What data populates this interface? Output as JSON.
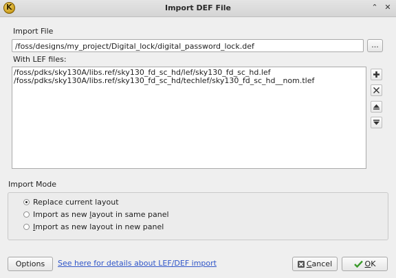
{
  "window": {
    "title": "Import DEF File",
    "app_icon_letter": "K"
  },
  "import_file": {
    "label": "Import File",
    "value": "/foss/designs/my_project/Digital_lock/digital_password_lock.def",
    "browse_label": "..."
  },
  "lef": {
    "label": "With LEF files:",
    "files": [
      "/foss/pdks/sky130A/libs.ref/sky130_fd_sc_hd/lef/sky130_fd_sc_hd.lef",
      "/foss/pdks/sky130A/libs.ref/sky130_fd_sc_hd/techlef/sky130_fd_sc_hd__nom.tlef"
    ],
    "buttons": [
      "add-icon",
      "remove-icon",
      "move-up-icon",
      "move-down-icon"
    ]
  },
  "import_mode": {
    "label": "Import Mode",
    "selected": 0,
    "options": [
      {
        "label": "Replace current layout",
        "mnemonic_prefix": "Replace current layout",
        "mnemonic": "",
        "rest": ""
      },
      {
        "label": "Import as new layout in same panel",
        "mnemonic_prefix": "Import as new ",
        "mnemonic": "l",
        "rest": "ayout in same panel"
      },
      {
        "label": "Import as new layout in new panel",
        "mnemonic_prefix": "",
        "mnemonic": "I",
        "rest": "mport as new layout in new panel"
      }
    ]
  },
  "footer": {
    "options_label": "Options",
    "help_link": "See here for details about LEF/DEF import",
    "cancel_label": "Cancel",
    "cancel_mnemonic": "C",
    "cancel_rest": "ancel",
    "ok_label": "OK",
    "ok_mnemonic": "O",
    "ok_rest": "K"
  },
  "colors": {
    "link": "#2f55c8",
    "ok_check": "#3a9a2a",
    "cancel_icon": "#555555"
  }
}
